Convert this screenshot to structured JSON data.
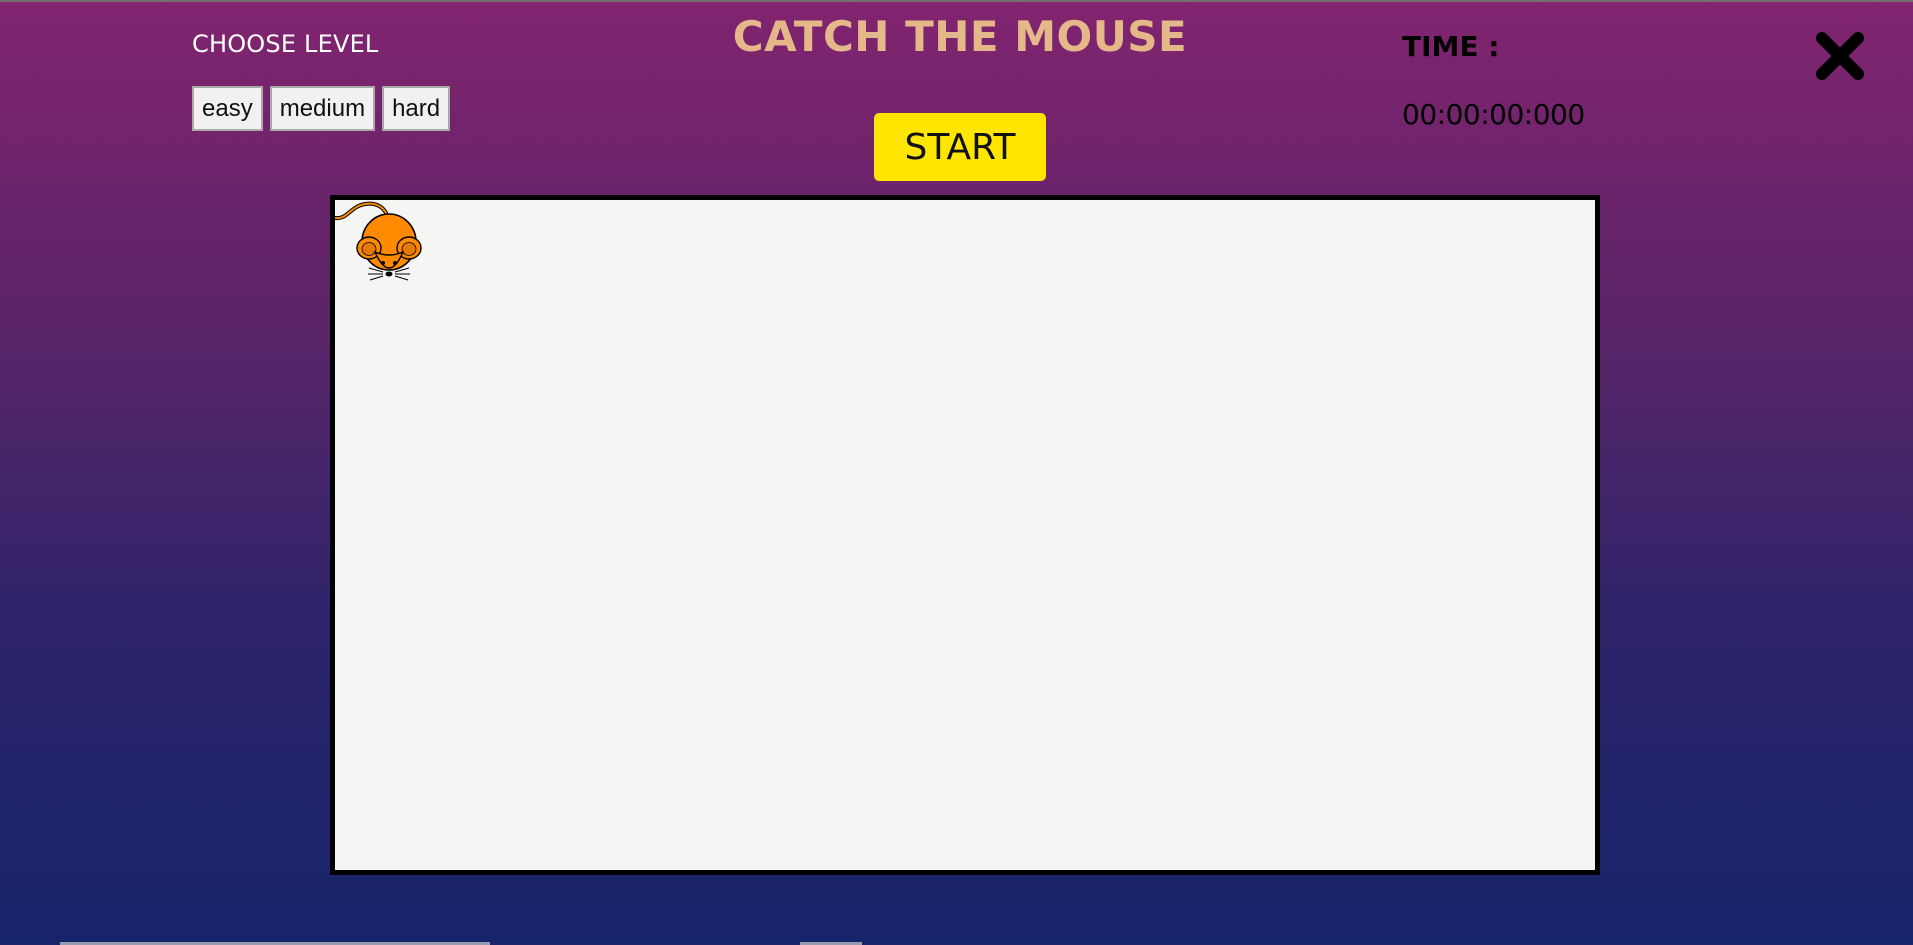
{
  "header": {
    "level_label": "CHOOSE LEVEL",
    "title": "CATCH THE MOUSE",
    "start_label": "START",
    "time_label": "TIME :",
    "time_value": "00:00:00:000"
  },
  "levels": [
    {
      "label": "easy"
    },
    {
      "label": "medium"
    },
    {
      "label": "hard"
    }
  ],
  "icons": {
    "close": "close-icon",
    "mouse": "mouse-icon"
  },
  "colors": {
    "background_top": "#82246f",
    "background_bottom": "#16246b",
    "title": "#e5b88a",
    "start_button": "#ffe600",
    "mouse": "#ff8a00",
    "game_area": "#f5f5f4"
  }
}
